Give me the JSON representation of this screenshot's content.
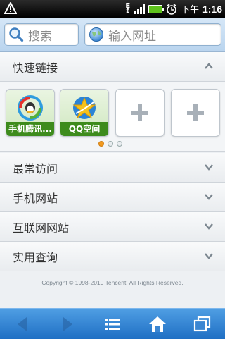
{
  "statusbar": {
    "ampm": "下午",
    "time": "1:16",
    "network_label": "E"
  },
  "search": {
    "placeholder": "搜索"
  },
  "url": {
    "placeholder": "输入网址"
  },
  "quick_links": {
    "title": "快速链接",
    "tiles": [
      {
        "label": "手机腾讯..."
      },
      {
        "label": "QQ空间"
      },
      {
        "label": ""
      },
      {
        "label": ""
      }
    ],
    "page_count": 3,
    "active_page": 1
  },
  "sections": [
    {
      "label": "最常访问"
    },
    {
      "label": "手机网站"
    },
    {
      "label": "互联网网站"
    },
    {
      "label": "实用查询"
    }
  ],
  "footer": {
    "copyright": "Copyright © 1998-2010 Tencent. All Rights Reserved."
  },
  "colors": {
    "toolbar": "#2f82d4",
    "header": "#c8ddf2",
    "tile_caption": "#3d8b1c",
    "active_dot": "#f29a20"
  }
}
